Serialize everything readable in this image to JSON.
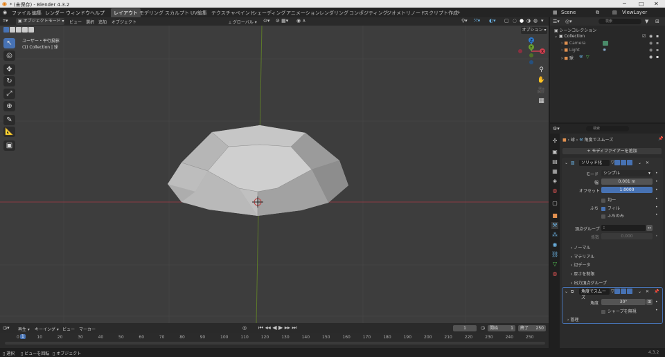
{
  "window": {
    "title": "* (未保存) - Blender 4.3.2",
    "min": "─",
    "max": "□",
    "close": "✕"
  },
  "menu": {
    "items": [
      "ファイル",
      "編集",
      "レンダー",
      "ウィンドウ",
      "ヘルプ"
    ]
  },
  "workspaces": [
    "レイアウト",
    "モデリング",
    "スカルプト",
    "UV編集",
    "テクスチャペイント",
    "シェーディング",
    "アニメーション",
    "レンダリング",
    "コンポジティング",
    "ジオメトリノード",
    "スクリプト作成"
  ],
  "add_tab": "+",
  "scene": {
    "label": "Scene",
    "viewlayer": "ViewLayer"
  },
  "viewport_header": {
    "mode": "オブジェクトモード",
    "menus": [
      "ビュー",
      "選択",
      "追加",
      "オブジェクト"
    ],
    "orientation": "グローバル",
    "options": "オプション"
  },
  "viewport": {
    "view_name": "ユーザー・平行投影",
    "collection_info": "(1) Collection | 球"
  },
  "gizmo": {
    "x": "X",
    "y": "Y",
    "z": "Z"
  },
  "timeline": {
    "menus": [
      "再生",
      "キーイング",
      "ビュー",
      "マーカー"
    ],
    "current_frame": "1",
    "start_label": "開始",
    "start": "1",
    "end_label": "終了",
    "end": "250",
    "ticks": [
      "0",
      "10",
      "20",
      "30",
      "40",
      "50",
      "60",
      "70",
      "80",
      "90",
      "100",
      "110",
      "120",
      "130",
      "140",
      "150",
      "160",
      "170",
      "180",
      "190",
      "200",
      "210",
      "220",
      "230",
      "240",
      "250"
    ],
    "playhead": "1"
  },
  "statusbar": {
    "select": "選択",
    "rotate": "ビューを回転",
    "object": "オブジェクト",
    "version": "4.3.2"
  },
  "outliner": {
    "search_placeholder": "検索",
    "root": "シーンコレクション",
    "collection": "Collection",
    "items": [
      "Camera",
      "Light",
      "球"
    ]
  },
  "properties": {
    "search_placeholder": "検索",
    "breadcrumb_object": "球",
    "breadcrumb_mod": "角度でスムーズ",
    "add_modifier": "モディファイアーを追加",
    "solidify": {
      "name": "ソリッド化",
      "mode_label": "モード",
      "mode_value": "シンプル",
      "width_label": "幅",
      "width_value": "0.001 m",
      "offset_label": "オフセット",
      "offset_value": "1.0000",
      "even_label": "均一",
      "rim_label": "ふち",
      "fill_label": "フィル",
      "rim_only_label": "ふちのみ",
      "vgroup_label": "頂点グループ",
      "factor_label": "係数",
      "factor_value": "0.000",
      "sections": [
        "ノーマル",
        "マテリアル",
        "辺データ",
        "厚さを制限",
        "出力頂点グループ"
      ]
    },
    "smooth": {
      "name": "角度でスムーズ",
      "angle_label": "角度",
      "angle_value": "30°",
      "sharp_label": "シャープを無視",
      "manage": "管理"
    }
  }
}
